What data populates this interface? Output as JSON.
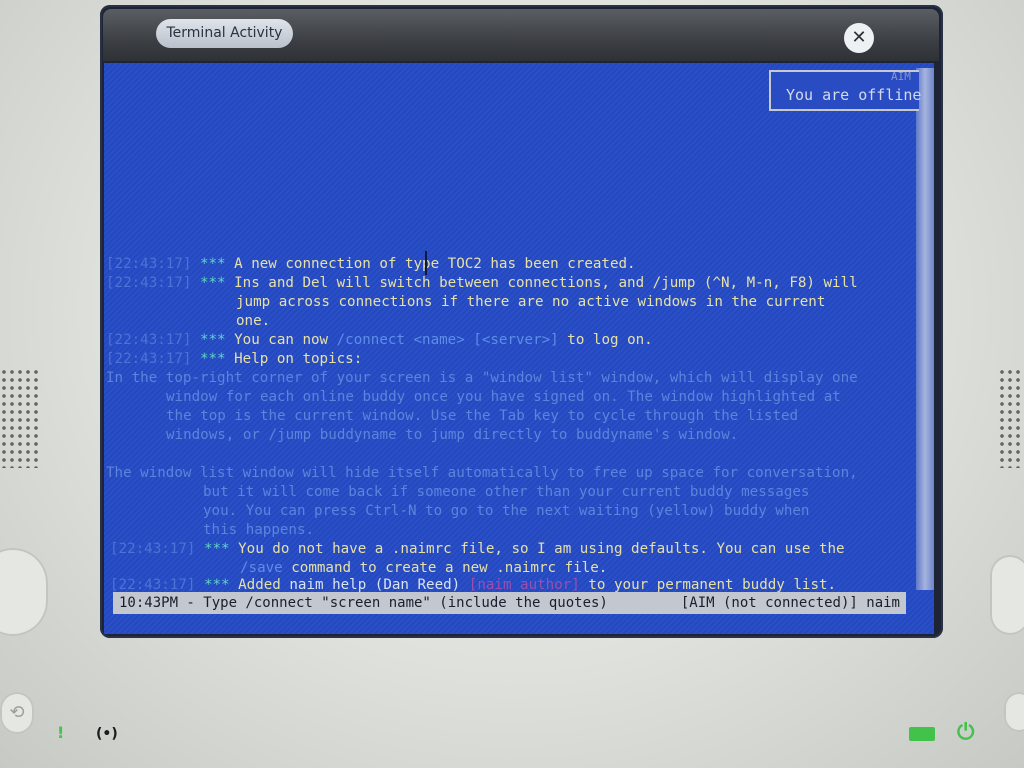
{
  "window": {
    "activity_label": "Terminal Activity",
    "close_icon": "close-icon"
  },
  "window_list": {
    "tag": "AIM",
    "status": "You are offline"
  },
  "log": [
    {
      "ts": "[22:43:17]",
      "stars": "***",
      "parts": [
        {
          "t": "A new connection of type TOC2 has been created.",
          "c": "text"
        }
      ]
    },
    {
      "ts": "[22:43:17]",
      "stars": "***",
      "parts": [
        {
          "t": "Ins and Del will switch between connections, and /jump (^N, M-n, F8) will",
          "c": "text"
        }
      ]
    },
    {
      "ts": "",
      "stars": "",
      "parts": [
        {
          "t": "jump across connections if there are no active windows in the current",
          "c": "text"
        }
      ]
    },
    {
      "ts": "",
      "stars": "",
      "parts": [
        {
          "t": "one.",
          "c": "text"
        }
      ]
    },
    {
      "ts": "[22:43:17]",
      "stars": "***",
      "parts": [
        {
          "t": "You can now ",
          "c": "text"
        },
        {
          "t": "/connect <name> [<server>]",
          "c": "cmd"
        },
        {
          "t": " to log on.",
          "c": "text"
        }
      ]
    },
    {
      "ts": "[22:43:17]",
      "stars": "***",
      "parts": [
        {
          "t": "Help on topics:",
          "c": "text"
        }
      ]
    },
    {
      "ts": "",
      "stars": "",
      "parts": [
        {
          "t": "In the top-right corner of your screen is a \"window list\" window, which will display one",
          "c": "help"
        }
      ]
    },
    {
      "ts": "",
      "stars": "",
      "parts": [
        {
          "t": "window for each online buddy once you have signed on. The window highlighted at",
          "c": "help"
        }
      ]
    },
    {
      "ts": "",
      "stars": "",
      "parts": [
        {
          "t": "the top is the current window. Use the Tab key to cycle through the listed",
          "c": "help"
        }
      ]
    },
    {
      "ts": "",
      "stars": "",
      "parts": [
        {
          "t": "windows, or /jump buddyname to jump directly to buddyname's window.",
          "c": "help"
        }
      ]
    },
    {
      "ts": "",
      "stars": "",
      "parts": [
        {
          "t": "The window list window will hide itself automatically to free up space for conversation,",
          "c": "help"
        }
      ]
    },
    {
      "ts": "",
      "stars": "",
      "parts": [
        {
          "t": "but it will come back if someone other than your current buddy messages",
          "c": "help"
        }
      ]
    },
    {
      "ts": "",
      "stars": "",
      "parts": [
        {
          "t": "you. You can press Ctrl-N to go to the next waiting (yellow) buddy when",
          "c": "help"
        }
      ]
    },
    {
      "ts": "",
      "stars": "",
      "parts": [
        {
          "t": "this happens.",
          "c": "help"
        }
      ]
    },
    {
      "ts": "[22:43:17]",
      "stars": "***",
      "parts": [
        {
          "t": "You do not have a .naimrc file, so I am using defaults. You can use the",
          "c": "text"
        }
      ]
    },
    {
      "ts": "",
      "stars": "",
      "parts": [
        {
          "t": "/save",
          "c": "cmd"
        },
        {
          "t": " command to create a new .naimrc file.",
          "c": "text"
        }
      ]
    },
    {
      "ts": "[22:43:17]",
      "stars": "***",
      "parts": [
        {
          "t": "Added ",
          "c": "text"
        },
        {
          "t": "naim help (Dan Reed)",
          "c": "hl"
        },
        {
          "t": " ",
          "c": "text"
        },
        {
          "t": "[naim author]",
          "c": "author"
        },
        {
          "t": " to your permanent buddy list.",
          "c": "text"
        }
      ]
    }
  ],
  "statusbar": {
    "left": "10:43PM - Type /connect \"screen name\" (include the quotes)",
    "right": "[AIM (not connected)] naim"
  },
  "hardware": {
    "mic_icon": "microphone-icon",
    "camera_icon": "camera-icon",
    "battery_icon": "battery-icon",
    "power_icon": "power-icon",
    "battery_color": "#42c24a"
  }
}
